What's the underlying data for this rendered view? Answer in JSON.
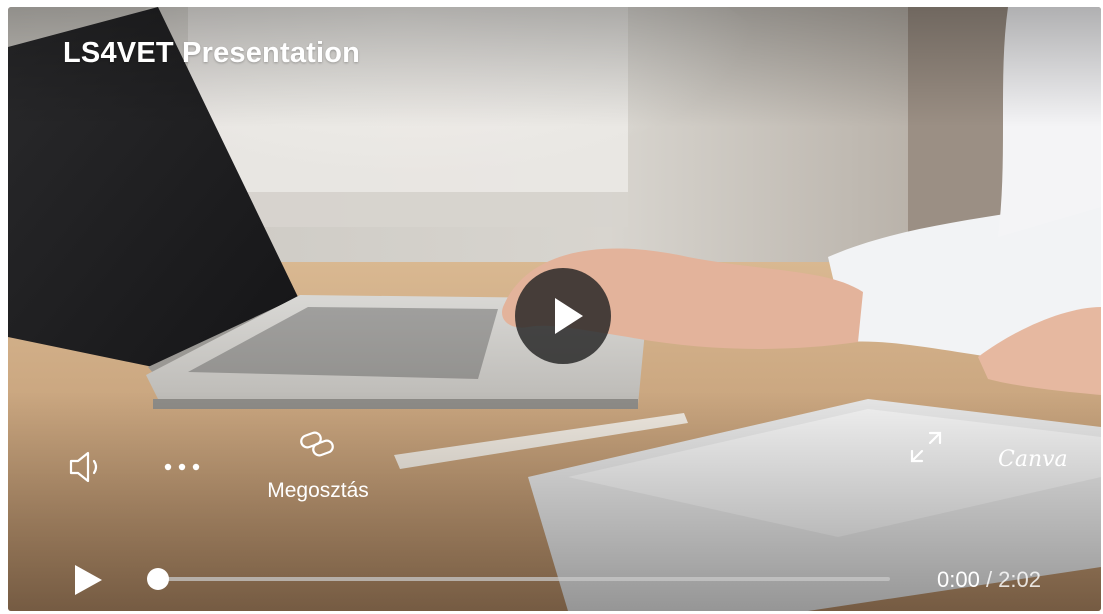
{
  "player": {
    "title": "LS4VET Presentation",
    "share_label": "Megosztás",
    "brand": "Canva",
    "time_current": "0:00",
    "time_separator": " / ",
    "time_total": "2:02",
    "progress": 0
  },
  "icons": {
    "center_play": "play-icon",
    "volume": "speaker-icon",
    "more": "more-dots-icon",
    "share": "link-icon",
    "fullscreen": "expand-icon",
    "bottom_play": "play-icon"
  },
  "colors": {
    "overlay_text": "#ffffff",
    "play_circle": "#2a2a2a"
  }
}
